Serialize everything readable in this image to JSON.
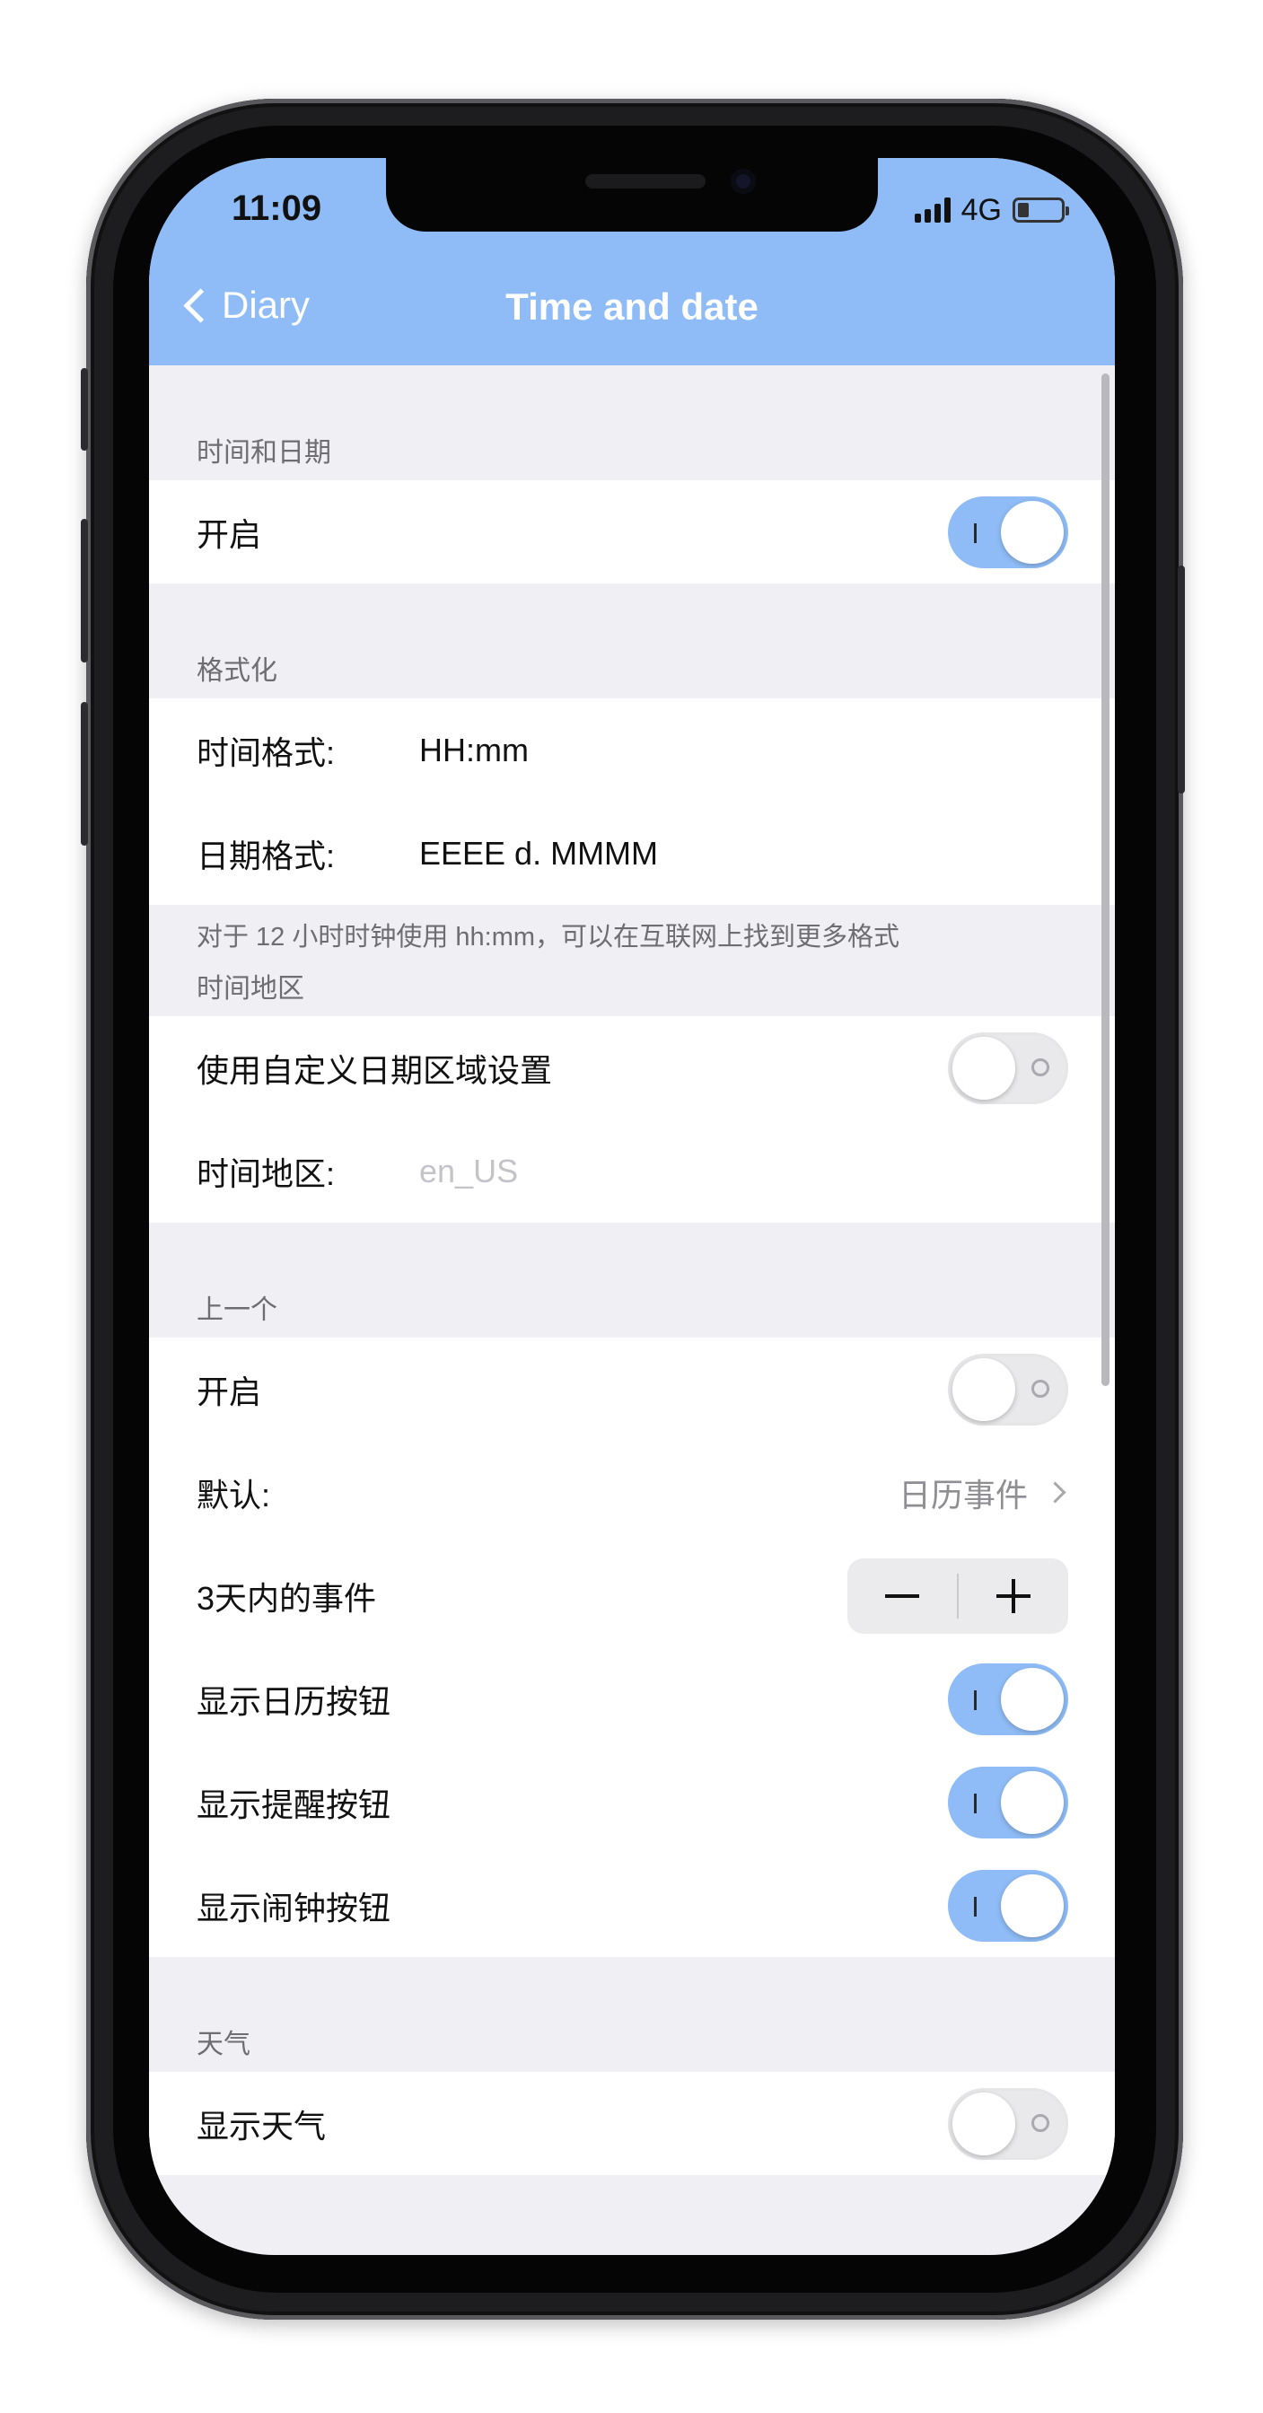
{
  "status_bar": {
    "time": "11:09",
    "network": "4G"
  },
  "nav": {
    "back_label": "Diary",
    "title": "Time and date"
  },
  "sections": {
    "time_date": {
      "header": "时间和日期",
      "enable_label": "开启",
      "enable_on": true
    },
    "format": {
      "header": "格式化",
      "time_format_label": "时间格式:",
      "time_format_value": "HH:mm",
      "date_format_label": "日期格式:",
      "date_format_value": "EEEE d. MMMM",
      "footer": "对于 12 小时时钟使用 hh:mm，可以在互联网上找到更多格式"
    },
    "locale": {
      "header": "时间地区",
      "custom_locale_label": "使用自定义日期区域设置",
      "custom_locale_on": false,
      "locale_label": "时间地区:",
      "locale_placeholder": "en_US"
    },
    "previous": {
      "header": "上一个",
      "enable_label": "开启",
      "enable_on": false,
      "default_label": "默认:",
      "default_value": "日历事件",
      "events_label": "3天内的事件",
      "show_calendar_label": "显示日历按钮",
      "show_calendar_on": true,
      "show_reminder_label": "显示提醒按钮",
      "show_reminder_on": true,
      "show_alarm_label": "显示闹钟按钮",
      "show_alarm_on": true
    },
    "weather": {
      "header": "天气",
      "show_weather_label": "显示天气",
      "show_weather_on": false
    }
  },
  "icons": [
    "back-chevron-icon",
    "signal-bars-icon",
    "battery-icon",
    "disclosure-chevron-icon",
    "minus-icon",
    "plus-icon"
  ],
  "colors": {
    "accent": "#8fbcf6",
    "background": "#efeff4",
    "card": "#ffffff",
    "secondary_text": "#6d6d72"
  }
}
